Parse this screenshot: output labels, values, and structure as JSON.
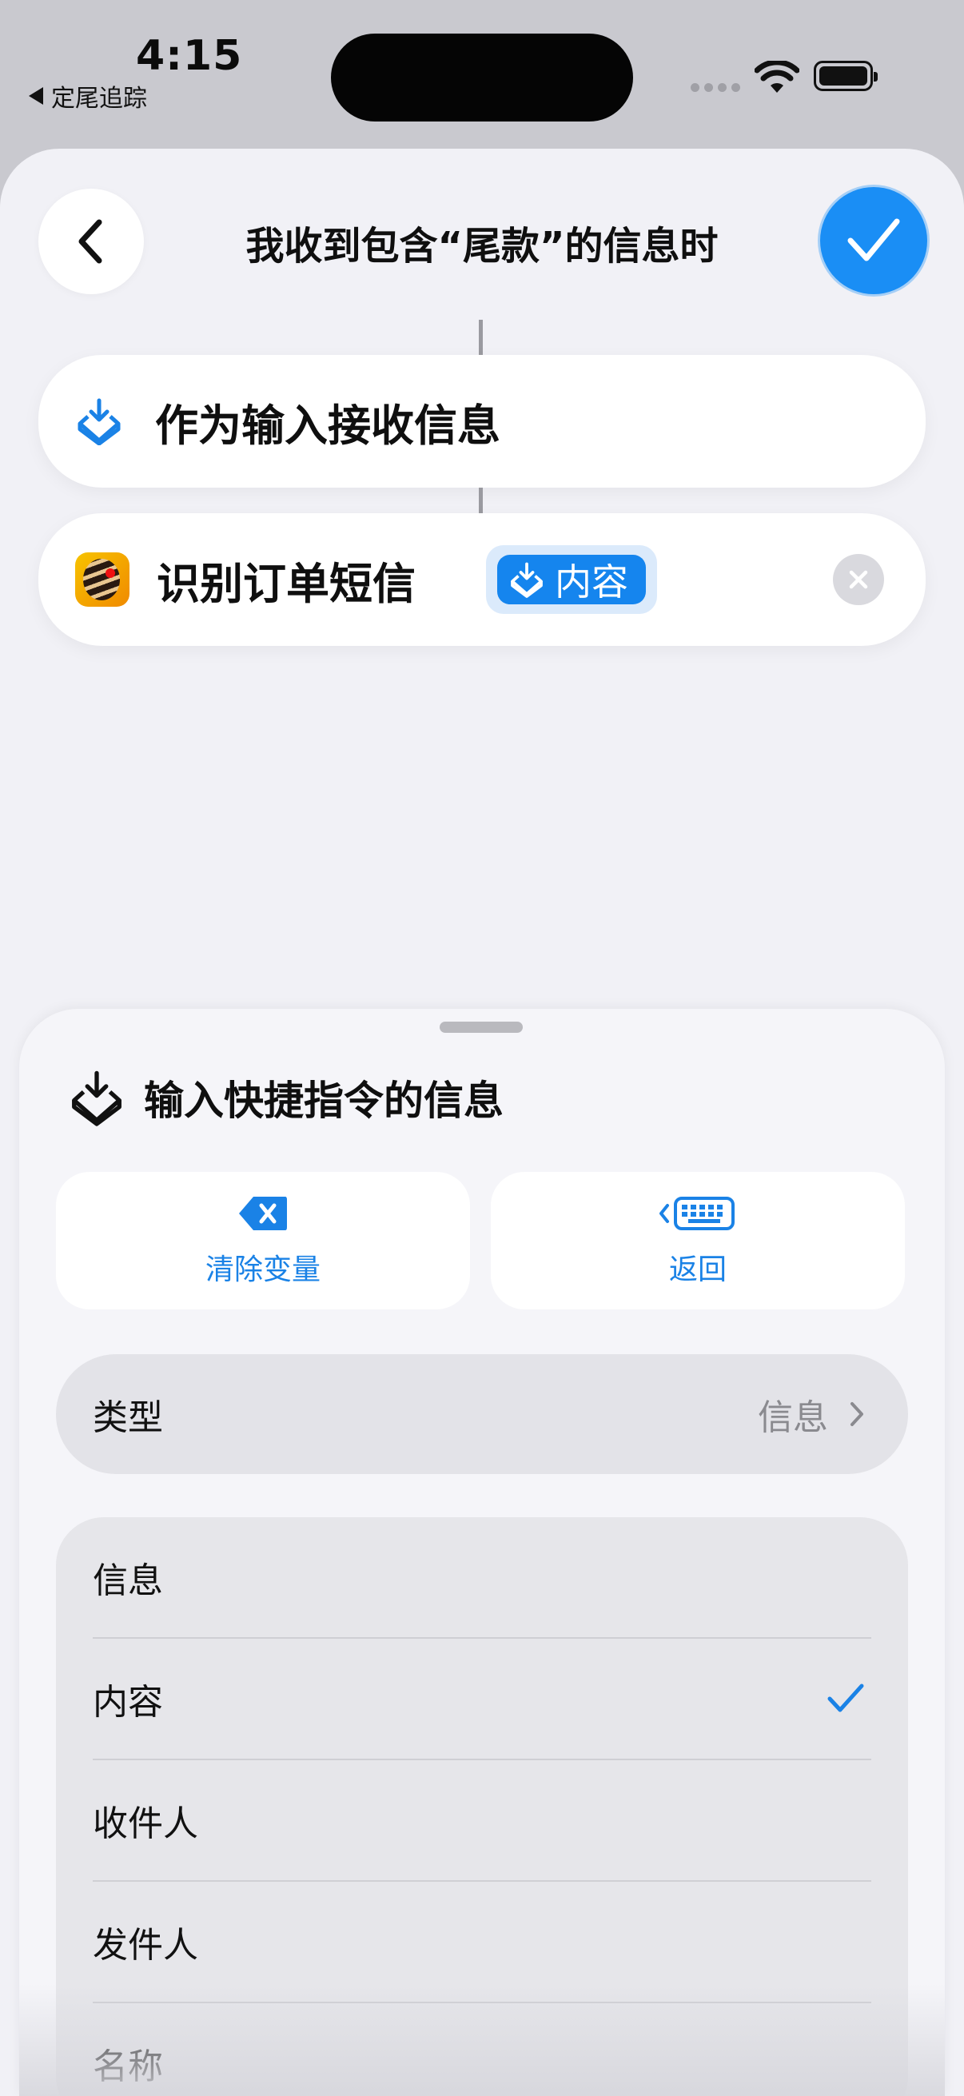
{
  "status_bar": {
    "time": "4:15",
    "back_app_label": "定尾追踪"
  },
  "nav": {
    "title": "我收到包含“尾款”的信息时",
    "back_icon": "chevron-left-icon",
    "done_icon": "checkmark-icon"
  },
  "actions": {
    "receive_input_label": "作为输入接收信息",
    "recognize_label": "识别订单短信",
    "variable_chip_label": "内容"
  },
  "panel": {
    "title": "输入快捷指令的信息",
    "clear_variable_label": "清除变量",
    "return_label": "返回",
    "type_row": {
      "label": "类型",
      "value": "信息"
    },
    "options": [
      {
        "label": "信息",
        "selected": false
      },
      {
        "label": "内容",
        "selected": true
      },
      {
        "label": "收件人",
        "selected": false
      },
      {
        "label": "发件人",
        "selected": false
      },
      {
        "label": "名称",
        "selected": false
      }
    ]
  },
  "colors": {
    "accent": "#1a8ef5",
    "background": "#f1f1f6",
    "card": "#ffffff"
  }
}
